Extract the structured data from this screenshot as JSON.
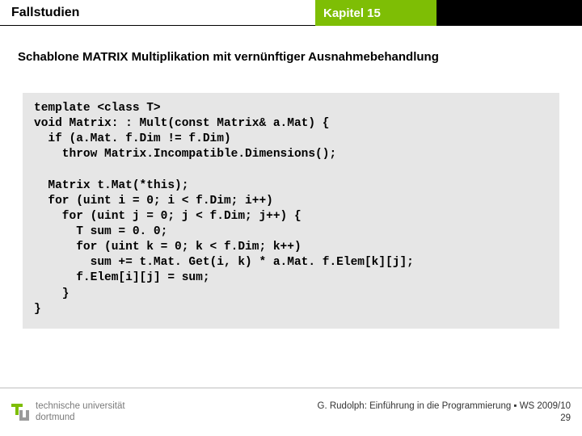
{
  "header": {
    "left": "Fallstudien",
    "chapter": "Kapitel 15"
  },
  "subtitle": "Schablone MATRIX Multiplikation mit vernünftiger Ausnahmebehandlung",
  "code": "template <class T>\nvoid Matrix: : Mult(const Matrix& a.Mat) {\n  if (a.Mat. f.Dim != f.Dim)\n    throw Matrix.Incompatible.Dimensions();\n\n  Matrix t.Mat(*this);\n  for (uint i = 0; i < f.Dim; i++)\n    for (uint j = 0; j < f.Dim; j++) {\n      T sum = 0. 0;\n      for (uint k = 0; k < f.Dim; k++)\n        sum += t.Mat. Get(i, k) * a.Mat. f.Elem[k][j];\n      f.Elem[i][j] = sum;\n    }\n}",
  "footer": {
    "uni_line1": "technische universität",
    "uni_line2": "dortmund",
    "credit": "G. Rudolph: Einführung in die Programmierung ▪ WS 2009/10",
    "page": "29"
  }
}
